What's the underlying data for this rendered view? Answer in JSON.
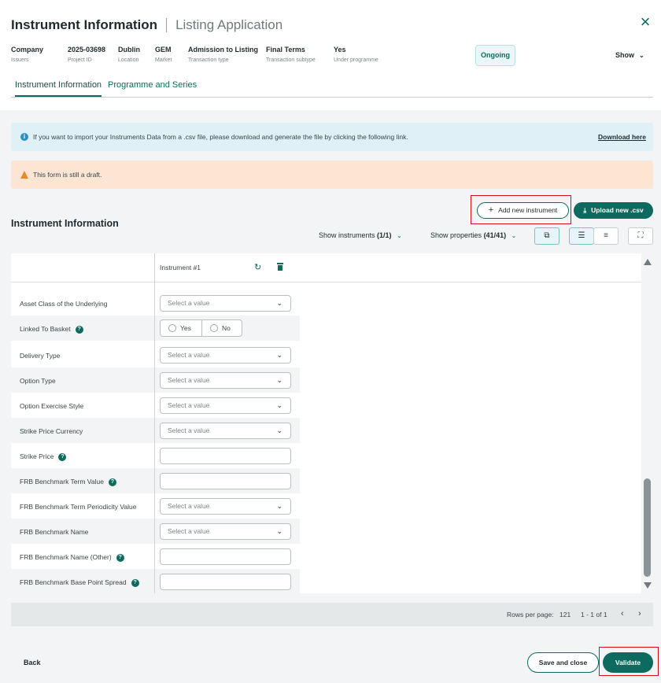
{
  "header": {
    "title": "Instrument Information",
    "subtitle": "Listing Application",
    "close_icon": "×",
    "meta": [
      {
        "value": "Company",
        "label": "Issuers"
      },
      {
        "value": "2025-03698",
        "label": "Project ID"
      },
      {
        "value": "Dublin",
        "label": "Location"
      },
      {
        "value": "GEM",
        "label": "Market"
      },
      {
        "value": "Admission to Listing",
        "label": "Transaction type"
      },
      {
        "value": "Final Terms",
        "label": "Transaction subtype"
      },
      {
        "value": "Yes",
        "label": "Under programme"
      }
    ],
    "status": "Ongoing",
    "show_label": "Show",
    "tabs": [
      "Instrument Information",
      "Programme and Series"
    ]
  },
  "banners": {
    "info_text": "If you want to import your Instruments Data from a .csv file, please download and generate the file by clicking the following link.",
    "info_link": "Download here",
    "draft_text": "This form is still a draft."
  },
  "section": {
    "title": "Instrument Information",
    "add_button": "Add new instrument",
    "upload_button": "Upload new .csv",
    "show_instruments_label": "Show instruments",
    "show_instruments_count": "(1/1)",
    "show_properties_label": "Show properties",
    "show_properties_count": "(41/41)"
  },
  "table": {
    "column_header": "Instrument #1",
    "select_placeholder": "Select a value",
    "radio_yes": "Yes",
    "radio_no": "No",
    "rows": [
      {
        "label": "Asset Class of the Underlying",
        "type": "select",
        "help": false
      },
      {
        "label": "Linked To Basket",
        "type": "radio",
        "help": true
      },
      {
        "label": "Delivery Type",
        "type": "select",
        "help": false
      },
      {
        "label": "Option Type",
        "type": "select",
        "help": false
      },
      {
        "label": "Option Exercise Style",
        "type": "select",
        "help": false
      },
      {
        "label": "Strike Price Currency",
        "type": "select",
        "help": false
      },
      {
        "label": "Strike Price",
        "type": "input",
        "help": true
      },
      {
        "label": "FRB Benchmark Term Value",
        "type": "input",
        "help": true
      },
      {
        "label": "FRB Benchmark Term Periodicity Value",
        "type": "select",
        "help": false
      },
      {
        "label": "FRB Benchmark Name",
        "type": "select",
        "help": false
      },
      {
        "label": "FRB Benchmark Name (Other)",
        "type": "input",
        "help": true
      },
      {
        "label": "FRB Benchmark Base Point Spread",
        "type": "input",
        "help": true
      }
    ]
  },
  "pager": {
    "rows_per_page_label": "Rows per page:",
    "rows_per_page_value": "121",
    "range": "1 - 1 of 1"
  },
  "footer": {
    "back": "Back",
    "save_close": "Save and close",
    "validate": "Validate"
  },
  "colors": {
    "accent": "#0c6b5e",
    "info_bg": "#dff1f7",
    "draft_bg": "#fce6d3",
    "highlight": "#c8141b"
  }
}
